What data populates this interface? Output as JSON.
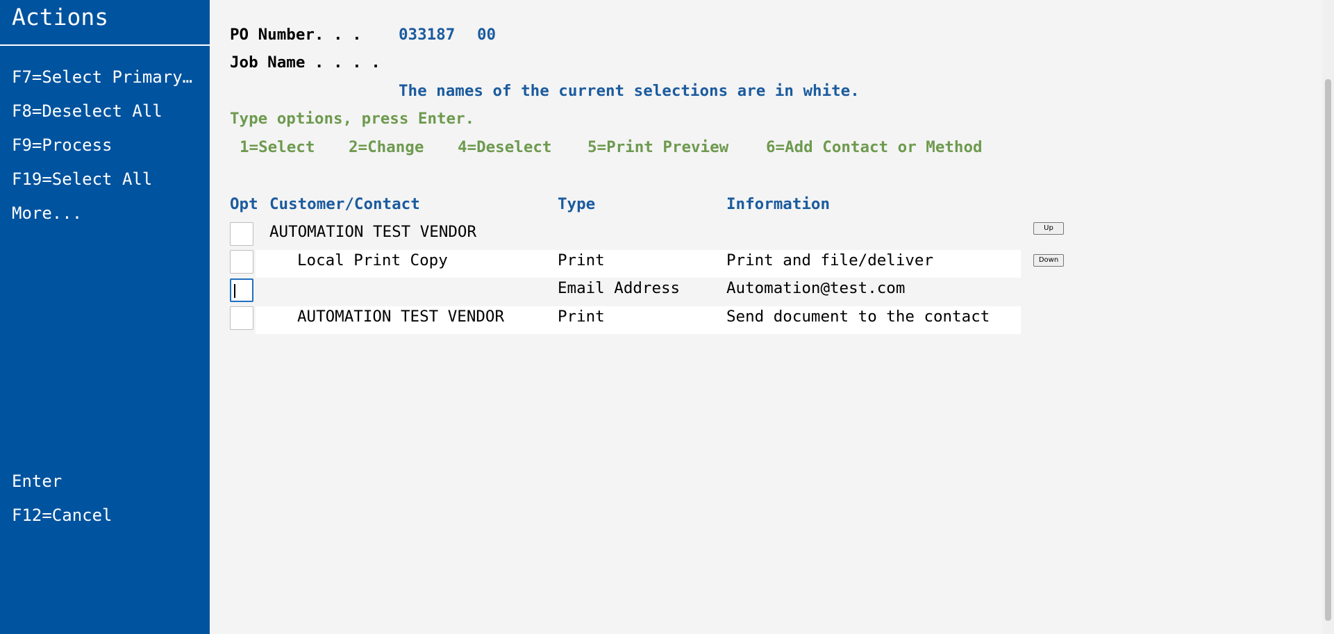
{
  "sidebar": {
    "title": "Actions",
    "top_items": [
      {
        "label": "F7=Select Primary..."
      },
      {
        "label": "F8=Deselect All"
      },
      {
        "label": "F9=Process"
      },
      {
        "label": "F19=Select All"
      },
      {
        "label": "More..."
      }
    ],
    "bottom_items": [
      {
        "label": "Enter"
      },
      {
        "label": "F12=Cancel"
      }
    ]
  },
  "form": {
    "po_label": "PO Number. . .",
    "po_number": "033187",
    "po_suffix": "00",
    "job_label": "Job Name . . . .",
    "note": "The names of the current selections are in white.",
    "instructions": "Type options, press Enter.",
    "options": [
      "1=Select",
      "2=Change",
      "4=Deselect",
      "5=Print Preview",
      "6=Add Contact or Method"
    ]
  },
  "table": {
    "headers": {
      "opt": "Opt",
      "customer": "Customer/Contact",
      "type": "Type",
      "information": "Information"
    },
    "rows": [
      {
        "opt": "",
        "customer": "AUTOMATION TEST VENDOR",
        "type": "",
        "information": ""
      },
      {
        "opt": "",
        "customer": "Local Print Copy",
        "type": "Print",
        "information": "Print and file/deliver"
      },
      {
        "opt": "",
        "customer": "",
        "type": "Email Address",
        "information": "Automation@test.com"
      },
      {
        "opt": "",
        "customer": "AUTOMATION TEST VENDOR",
        "type": "Print",
        "information": "Send document to the contact"
      }
    ]
  },
  "scroll": {
    "up_label": "Up",
    "down_label": "Down"
  },
  "colors": {
    "sidebar_bg": "#00539f",
    "page_bg": "#f4f4f4",
    "field_value_blue": "#1b5b9e",
    "option_green": "#6e9a4f",
    "focus_border": "#1f6fc0"
  }
}
